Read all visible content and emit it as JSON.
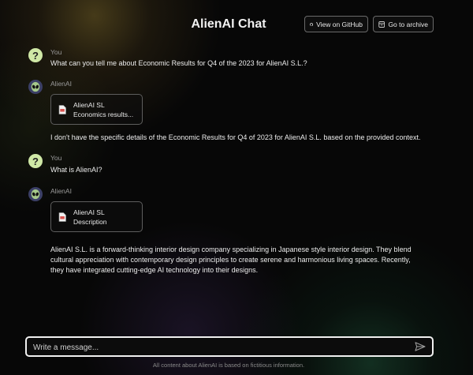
{
  "header": {
    "title": "AlienAI Chat",
    "github_button": "View on GitHub",
    "archive_button": "Go to archive",
    "github_icon": "github-icon",
    "archive_icon": "archive-icon"
  },
  "messages": [
    {
      "sender": "You",
      "avatar": "?",
      "text": "What can you tell me about Economic Results for Q4 of the 2023 for AlienAI S.L.?"
    },
    {
      "sender": "AlienAI",
      "avatar_icon": "alien-icon",
      "document": {
        "title": "AlienAI SL",
        "subtitle": "Economics results...",
        "icon": "document-icon"
      },
      "text": "I don't have the specific details of the Economic Results for Q4 of 2023 for AlienAI S.L. based on the provided context."
    },
    {
      "sender": "You",
      "avatar": "?",
      "text": "What is AlienAI?"
    },
    {
      "sender": "AlienAI",
      "avatar_icon": "alien-icon",
      "document": {
        "title": "AlienAI SL",
        "subtitle": "Description",
        "icon": "document-icon"
      },
      "text_lines": [
        "AlienAI S.L. is a forward-thinking interior design company specializing in Japanese style interior design. They blend",
        "cultural appreciation with contemporary design principles to create serene and harmonious living spaces. Recently,",
        "they have integrated cutting-edge AI technology into their designs."
      ]
    }
  ],
  "composer": {
    "placeholder": "Write a message...",
    "send_icon": "send-icon"
  },
  "footer": "All content about AlienAI is based on fictitious information.",
  "colors": {
    "user_avatar": "#cfe8a6",
    "ai_avatar": "#3b3f66",
    "background": "#070707"
  }
}
